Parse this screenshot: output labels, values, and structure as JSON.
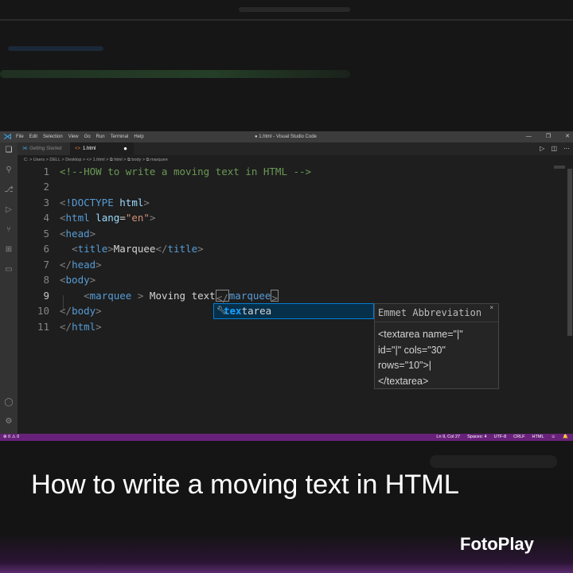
{
  "window": {
    "title": "● 1.html - Visual Studio Code",
    "menu": [
      "File",
      "Edit",
      "Selection",
      "View",
      "Go",
      "Run",
      "Terminal",
      "Help"
    ],
    "controls": [
      "—",
      "❐",
      "✕"
    ]
  },
  "tabs": [
    {
      "label": "Getting Started",
      "italic": true
    },
    {
      "label": "1.html",
      "modified": true
    }
  ],
  "breadcrumb": "C: > Users > DELL > Desktop > <> 1.html > ⧉ html > ⧉ body > ⧉ marquee",
  "editor": {
    "current_line": 9,
    "line_numbers": [
      "1",
      "2",
      "3",
      "4",
      "5",
      "6",
      "7",
      "8",
      "9",
      "10",
      "11"
    ]
  },
  "autocomplete": {
    "typed": "tex",
    "rest": "tarea",
    "details_title": "Emmet Abbreviation",
    "details_body": "<textarea name=\"|\"\nid=\"|\" cols=\"30\"\nrows=\"10\">|\n</textarea>"
  },
  "statusbar": {
    "left": "⊗ 0 ⚠ 0",
    "right": [
      "Ln 9, Col 27",
      "Spaces: 4",
      "UTF-8",
      "CRLF",
      "HTML",
      "☺",
      "🔔"
    ]
  },
  "caption": "How to write a moving text in HTML",
  "brand": "FotoPlay",
  "colors": {
    "statusbar": "#68217a",
    "comment": "#6a9955",
    "tag": "#569cd6",
    "attr": "#9cdcfe",
    "string": "#ce9178",
    "selection_highlight": "#18a3ff"
  }
}
